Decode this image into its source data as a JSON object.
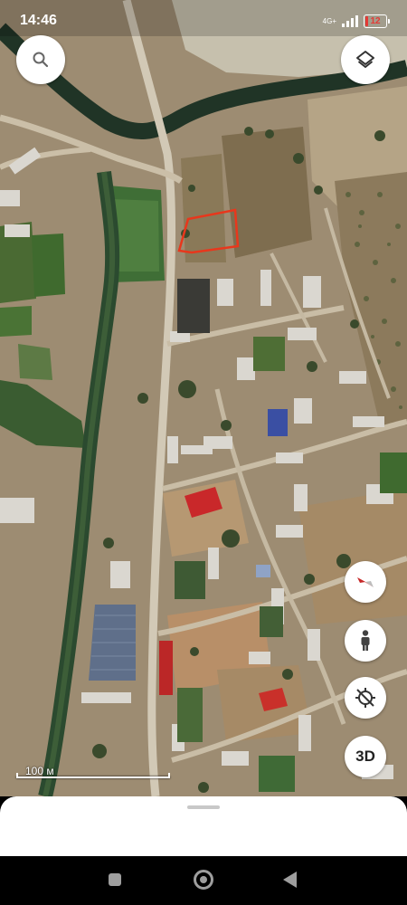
{
  "status_bar": {
    "time": "14:46",
    "network": "4G+",
    "battery": "12",
    "battery_color": "#e53935"
  },
  "map": {
    "type": "satellite",
    "scale_label": "100 м",
    "highlight_color": "#e8371c"
  },
  "controls": {
    "search_icon": "search-icon",
    "layers_icon": "layers-icon",
    "compass_icon": "compass-icon",
    "street_view_icon": "person-icon",
    "location_icon": "gps-disabled-icon",
    "btn_3d_label": "3D"
  },
  "nav_bar": {
    "recent_icon": "recent-apps-icon",
    "home_icon": "home-icon",
    "back_icon": "back-icon"
  }
}
